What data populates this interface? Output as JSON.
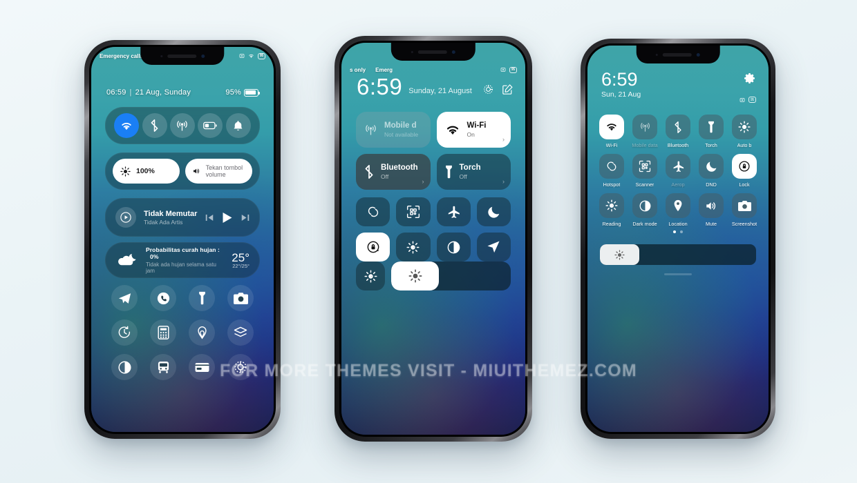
{
  "watermark": "FOR MORE THEMES VISIT - MIUITHEMEZ.COM",
  "colors": {
    "accent_blue": "#1a7ff5",
    "tile_white": "#ffffff",
    "wallpaper_top": "#3fa4a8",
    "wallpaper_bottom": "#1b2050"
  },
  "phone1": {
    "statusbar": {
      "carrier": "Emergency calls",
      "icons": [
        "screenshot-icon",
        "wifi-icon",
        "battery-icon"
      ],
      "battery_text": "95"
    },
    "header": {
      "time": "06:59",
      "separator": "|",
      "date": "21 Aug, Sunday",
      "battery_percent": "95%"
    },
    "toggles": [
      {
        "name": "wifi",
        "icon": "wifi-icon",
        "state": "on"
      },
      {
        "name": "bluetooth",
        "icon": "bluetooth-icon",
        "state": "off"
      },
      {
        "name": "mobile-data",
        "icon": "cellular-icon",
        "state": "off"
      },
      {
        "name": "battery-saver",
        "icon": "battery-icon",
        "state": "off"
      },
      {
        "name": "ringer",
        "icon": "bell-icon",
        "state": "off"
      }
    ],
    "sliders": {
      "brightness_label": "100%",
      "volume_label": "Tekan tombol volume"
    },
    "media": {
      "title": "Tidak Memutar",
      "artist": "Tidak Ada Artis",
      "controls": [
        "prev-icon",
        "play-icon",
        "next-icon"
      ]
    },
    "weather": {
      "line1_label": "Probabilitas curah hujan :",
      "line1_value": "0%",
      "line2": "Tidak ada hujan selama satu jam",
      "temp": "25°",
      "range": "22°/25°"
    },
    "apps": [
      "telegram-icon",
      "phone-icon",
      "torch-icon",
      "camera-icon",
      "timer-icon",
      "calculator-icon",
      "airdrop-icon",
      "layers-icon",
      "contrast-icon",
      "bus-icon",
      "wallet-icon",
      "settings-icon"
    ]
  },
  "phone2": {
    "statusbar": {
      "left1": "s only",
      "left2": "Emerg",
      "icons": [
        "screenshot-icon",
        "battery-icon"
      ],
      "battery_text": "95"
    },
    "clock": {
      "time": "6:59",
      "date": "Sunday, 21 August"
    },
    "header_actions": [
      "settings-icon",
      "edit-icon"
    ],
    "big_tiles": [
      {
        "title": "Mobile d",
        "subtitle": "Not available",
        "icon": "cellular-icon",
        "style": "dim"
      },
      {
        "title": "Wi-Fi",
        "subtitle": "On",
        "icon": "wifi-icon",
        "style": "white",
        "chevron": "›"
      },
      {
        "title": "Bluetooth",
        "subtitle": "Off",
        "icon": "bluetooth-icon",
        "style": "normal",
        "chevron": "›"
      },
      {
        "title": "Torch",
        "subtitle": "Off",
        "icon": "torch-icon",
        "style": "normal",
        "chevron": "›"
      }
    ],
    "small_tiles": [
      {
        "icon": "hotspot-icon",
        "style": "normal"
      },
      {
        "icon": "scanner-icon",
        "style": "normal"
      },
      {
        "icon": "airplane-icon",
        "style": "normal"
      },
      {
        "icon": "moon-icon",
        "style": "normal"
      },
      {
        "icon": "rotation-lock-icon",
        "style": "white"
      },
      {
        "icon": "reading-mode-icon",
        "style": "normal"
      },
      {
        "icon": "dark-mode-icon",
        "style": "normal"
      },
      {
        "icon": "location-icon",
        "style": "normal"
      }
    ],
    "brightness": {
      "auto_icon": "auto-brightness-icon",
      "slider_icon": "brightness-icon",
      "fill_percent": "40"
    }
  },
  "phone3": {
    "header": {
      "time": "6:59",
      "date": "Sun, 21 Aug",
      "gear": "settings-icon"
    },
    "statusbar": {
      "icons": [
        "screenshot-icon",
        "battery-icon"
      ],
      "battery_text": "95"
    },
    "tiles": [
      {
        "label": "Wi-Fi",
        "icon": "wifi-icon",
        "style": "white",
        "dim": false
      },
      {
        "label": "Mobile data",
        "icon": "cellular-icon",
        "style": "normal",
        "dim": true
      },
      {
        "label": "Bluetooth",
        "icon": "bluetooth-icon",
        "style": "normal",
        "dim": false
      },
      {
        "label": "Torch",
        "icon": "torch-icon",
        "style": "normal",
        "dim": false
      },
      {
        "label": "Auto b",
        "icon": "auto-brightness-icon",
        "style": "normal",
        "dim": false
      },
      {
        "label": "Hotspot",
        "icon": "hotspot-icon",
        "style": "normal",
        "dim": false
      },
      {
        "label": "Scanner",
        "icon": "scanner-icon",
        "style": "normal",
        "dim": false
      },
      {
        "label": "Aerop",
        "icon": "airplane-icon",
        "style": "normal",
        "dim": true
      },
      {
        "label": "DND",
        "icon": "moon-icon",
        "style": "normal",
        "dim": false
      },
      {
        "label": "Lock",
        "icon": "rotation-lock-icon",
        "style": "white",
        "dim": false
      },
      {
        "label": "Reading",
        "icon": "reading-mode-icon",
        "style": "normal",
        "dim": false
      },
      {
        "label": "Dark mode",
        "icon": "dark-mode-icon",
        "style": "normal",
        "dim": false
      },
      {
        "label": "Location",
        "icon": "location-icon",
        "style": "normal",
        "dim": false
      },
      {
        "label": "Mute",
        "icon": "mute-icon",
        "style": "normal",
        "dim": false
      },
      {
        "label": "Screenshot",
        "icon": "camera-icon",
        "style": "normal",
        "dim": false
      }
    ],
    "pager": {
      "pages": 2,
      "active": 1
    },
    "brightness": {
      "icon": "brightness-icon",
      "fill_percent": "25"
    }
  }
}
